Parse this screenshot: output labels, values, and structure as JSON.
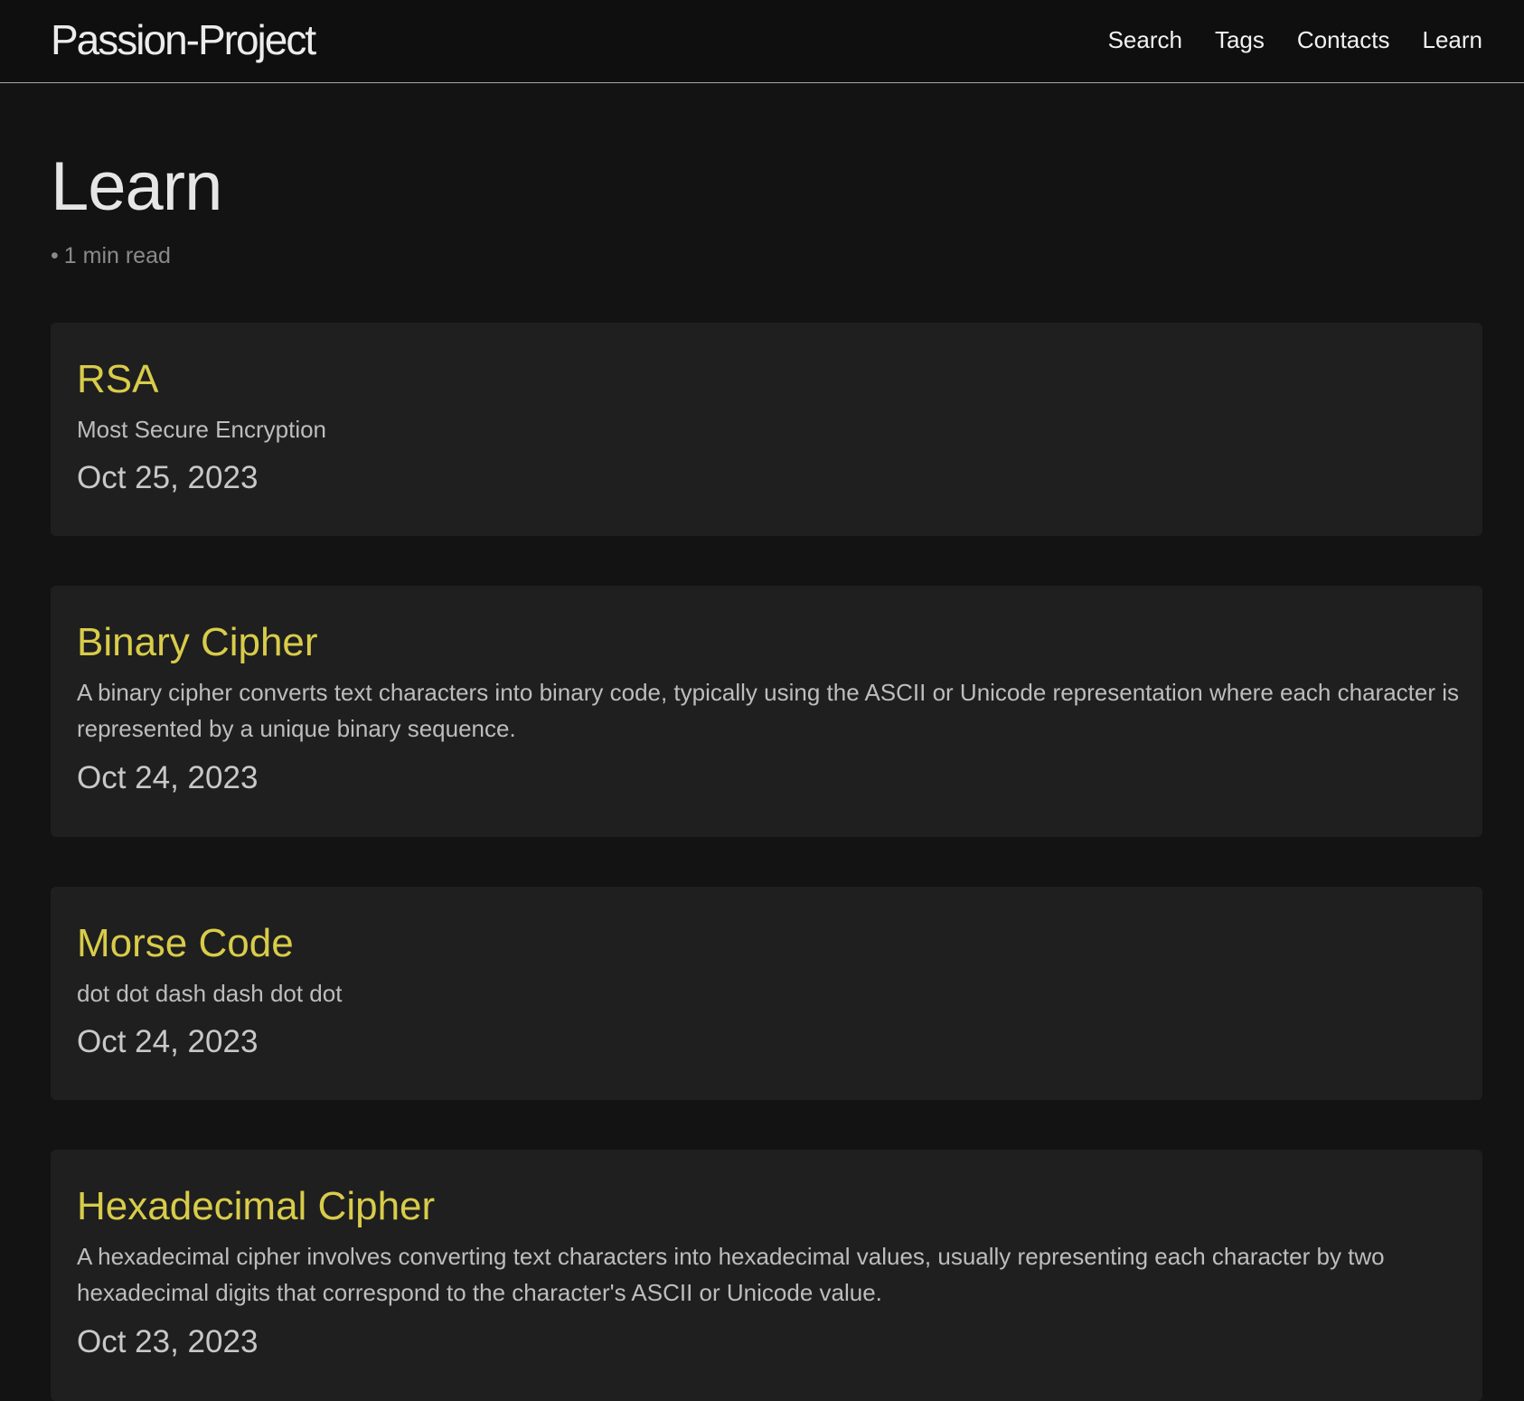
{
  "header": {
    "site_title": "Passion-Project",
    "nav": [
      "Search",
      "Tags",
      "Contacts",
      "Learn"
    ]
  },
  "page": {
    "title": "Learn",
    "read_dot": "•",
    "read_time": "1 min read"
  },
  "posts": [
    {
      "title": "RSA",
      "description": "Most Secure Encryption",
      "date": "Oct 25, 2023"
    },
    {
      "title": "Binary Cipher",
      "description": "A binary cipher converts text characters into binary code, typically using the ASCII or Unicode representation where each character is represented by a unique binary sequence.",
      "date": "Oct 24, 2023"
    },
    {
      "title": "Morse Code",
      "description": "dot dot dash dash dot dot",
      "date": "Oct 24, 2023"
    },
    {
      "title": "Hexadecimal Cipher",
      "description": "A hexadecimal cipher involves converting text characters into hexadecimal values, usually representing each character by two hexadecimal digits that correspond to the character's ASCII or Unicode value.",
      "date": "Oct 23, 2023"
    }
  ],
  "colors": {
    "background": "#131313",
    "header_bg": "#0f0f0f",
    "card_bg": "#1f1f1f",
    "accent_title": "#d8cc4a",
    "text": "#e6e6e6",
    "muted": "#8a8a8a"
  }
}
